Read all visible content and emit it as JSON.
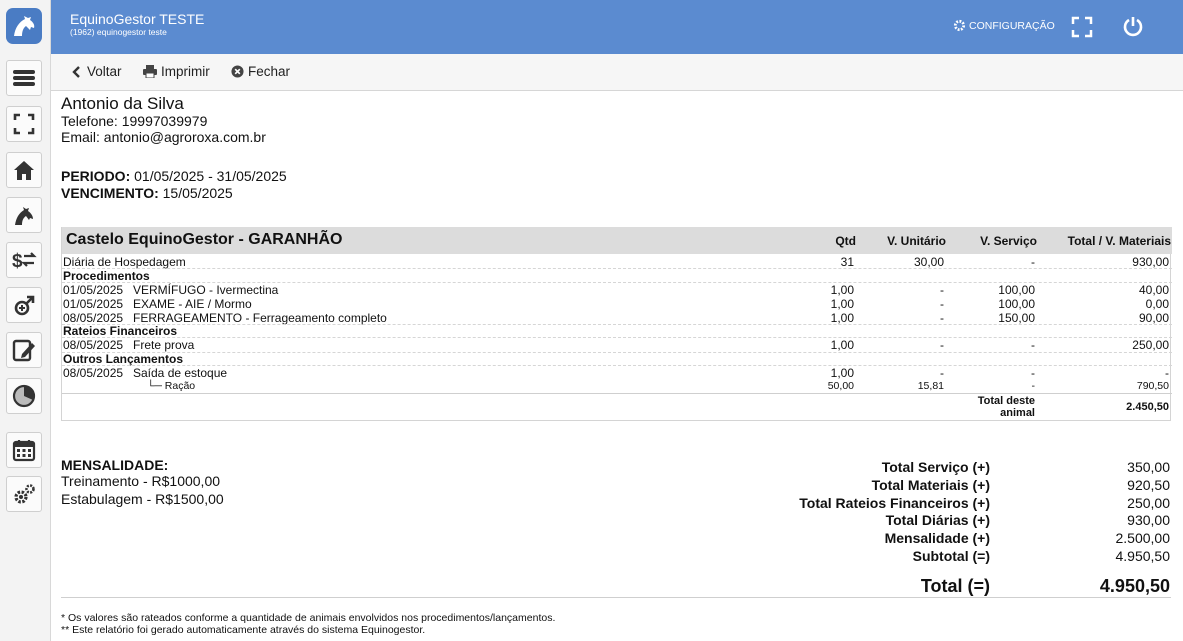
{
  "app": {
    "title": "EquinoGestor TESTE",
    "subtitle": "(1962) equinogestor teste",
    "config_label": "CONFIGURAÇÃO"
  },
  "sidebar": {
    "icons": [
      "menu-icon",
      "fullscreen-icon",
      "home-icon",
      "horse-icon",
      "money-transfer-icon",
      "male-gender-icon",
      "edit-report-icon",
      "pie-chart-icon",
      "calendar-icon",
      "gears-icon"
    ]
  },
  "toolbar": {
    "back_label": "Voltar",
    "print_label": "Imprimir",
    "close_label": "Fechar"
  },
  "client": {
    "name": "Antonio da Silva",
    "phone_label": "Telefone:",
    "phone": "19997039979",
    "email_label": "Email:",
    "email": "antonio@agroroxa.com.br"
  },
  "period": {
    "label": "PERIODO:",
    "value": "01/05/2025 - 31/05/2025"
  },
  "due": {
    "label": "VENCIMENTO:",
    "value": "15/05/2025"
  },
  "table": {
    "animal": "Castelo EquinoGestor - GARANHÃO",
    "headers": {
      "qtd": "Qtd",
      "unit": "V. Unitário",
      "service": "V. Serviço",
      "total": "Total / V. Materiais"
    },
    "hospedagem": {
      "desc": "Diária de Hospedagem",
      "qtd": "31",
      "unit": "30,00",
      "service": "-",
      "total": "930,00"
    },
    "procedimentos_title": "Procedimentos",
    "procedimentos": [
      {
        "date": "01/05/2025",
        "desc": "VERMÍFUGO - Ivermectina",
        "qtd": "1,00",
        "unit": "-",
        "service": "100,00",
        "total": "40,00"
      },
      {
        "date": "01/05/2025",
        "desc": "EXAME - AIE / Mormo",
        "qtd": "1,00",
        "unit": "-",
        "service": "100,00",
        "total": "0,00"
      },
      {
        "date": "08/05/2025",
        "desc": "FERRAGEAMENTO - Ferrageamento completo",
        "qtd": "1,00",
        "unit": "-",
        "service": "150,00",
        "total": "90,00"
      }
    ],
    "rateios_title": "Rateios Financeiros",
    "rateios": [
      {
        "date": "08/05/2025",
        "desc": "Frete prova",
        "qtd": "1,00",
        "unit": "-",
        "service": "-",
        "total": "250,00"
      }
    ],
    "outros_title": "Outros Lançamentos",
    "outros": [
      {
        "date": "08/05/2025",
        "desc": "Saída de estoque",
        "qtd": "1,00",
        "unit": "-",
        "service": "-",
        "total": "-"
      }
    ],
    "sub_item": {
      "desc": "└─ Ração",
      "qtd": "50,00",
      "unit": "15,81",
      "service": "-",
      "total": "790,50"
    },
    "animal_total_label_1": "Total deste",
    "animal_total_label_2": "animal",
    "animal_total": "2.450,50"
  },
  "mensalidade": {
    "title": "MENSALIDADE:",
    "items": [
      "Treinamento - R$1000,00",
      "Estabulagem - R$1500,00"
    ]
  },
  "totals": [
    {
      "label": "Total Serviço (+)",
      "value": "350,00"
    },
    {
      "label": "Total Materiais (+)",
      "value": "920,50"
    },
    {
      "label": "Total Rateios Financeiros (+)",
      "value": "250,00"
    },
    {
      "label": "Total Diárias (+)",
      "value": "930,00"
    },
    {
      "label": "Mensalidade (+)",
      "value": "2.500,00"
    },
    {
      "label": "Subtotal (=)",
      "value": "4.950,50"
    }
  ],
  "grand_total": {
    "label": "Total (=)",
    "value": "4.950,50"
  },
  "footnotes": [
    "* Os valores são rateados conforme a quantidade de animais envolvidos nos procedimentos/lançamentos.",
    "** Este relatório foi gerado automaticamente através do sistema Equinogestor."
  ]
}
